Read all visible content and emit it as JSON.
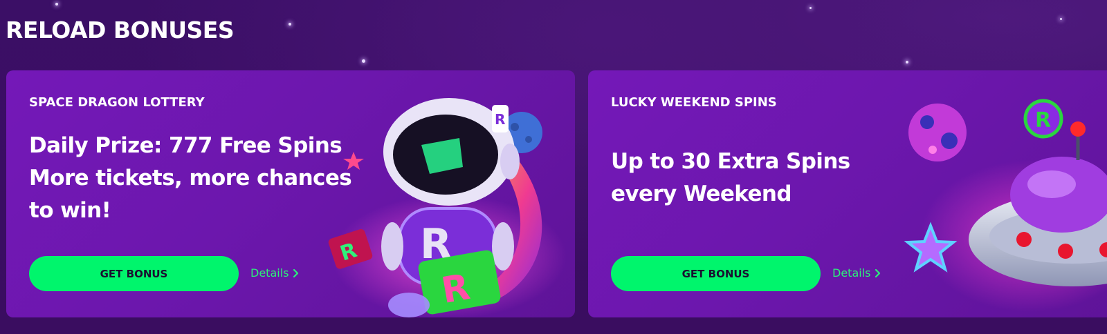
{
  "section": {
    "title": "RELOAD BONUSES"
  },
  "cards": [
    {
      "label": "SPACE DRAGON LOTTERY",
      "headline": "Daily Prize: 777 Free Spins More tickets, more chances to win!",
      "button_label": "GET BONUS",
      "details_label": "Details",
      "art": "astronaut-robot-with-r-ticket"
    },
    {
      "label": "LUCKY WEEKEND SPINS",
      "headline": "Up to 30 Extra Spins every Weekend",
      "button_label": "GET BONUS",
      "details_label": "Details",
      "art": "ufo-with-planet-and-r-coin"
    }
  ],
  "colors": {
    "background": "#3a0e63",
    "card": "#6c17ad",
    "accent_button": "#00f56c",
    "details_link": "#2cf07a",
    "text": "#ffffff"
  }
}
